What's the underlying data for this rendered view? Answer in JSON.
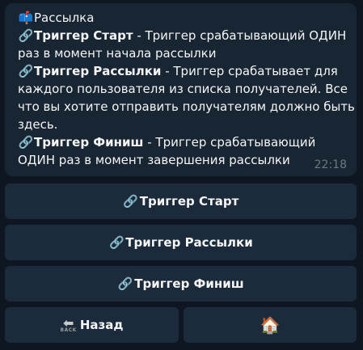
{
  "message": {
    "header_icon": "📫",
    "header_text": "Рассылка",
    "link_icon": "🔗",
    "items": [
      {
        "title": "Триггер Старт",
        "desc": " - Триггер срабатывающий ОДИН",
        "cont": "раз в момент начала рассылки"
      },
      {
        "title": "Триггер Рассылки",
        "desc": " - Триггер срабатывает для",
        "cont1": "каждого пользователя из списка получателей. Все",
        "cont2": "что вы хотите отправить получателям должно быть",
        "cont3": "здесь."
      },
      {
        "title": "Триггер Финиш",
        "desc": " - Триггер срабатывающий",
        "cont": "ОДИН раз в момент завершения рассылки"
      }
    ],
    "time": "22:18"
  },
  "keyboard": {
    "btn_start": "Триггер Старт",
    "btn_mailing": "Триггер Рассылки",
    "btn_finish": "Триггер Финиш",
    "btn_back": "Назад",
    "back_icon_text": "BACK",
    "home_icon": "🏠"
  },
  "colors": {
    "background": "#0e1621",
    "bubble": "#182533",
    "button": "#1c2b3b",
    "time": "#6c7883"
  },
  "icons": [
    "mailbox-icon",
    "link-icon",
    "back-arrow-icon",
    "house-icon"
  ]
}
